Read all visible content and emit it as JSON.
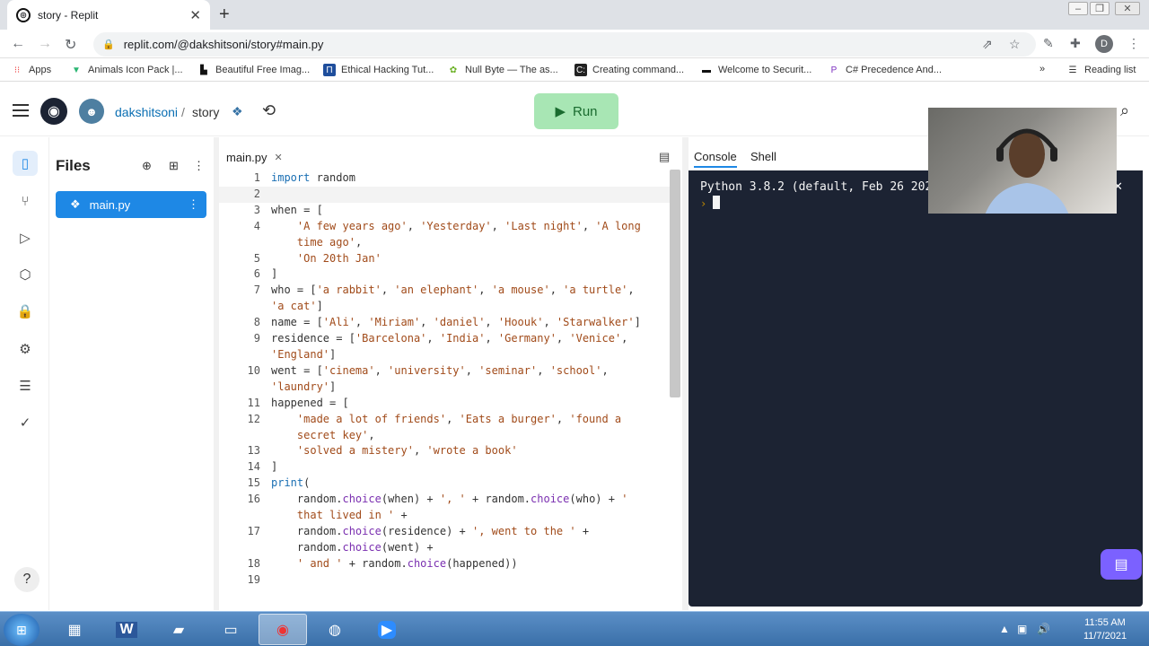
{
  "browser": {
    "tab_title": "story - Replit",
    "url": "replit.com/@dakshitsoni/story#main.py",
    "profile_initial": "D",
    "reading_list": "Reading list",
    "bookmarks": [
      {
        "label": "Apps"
      },
      {
        "label": "Animals Icon Pack |..."
      },
      {
        "label": "Beautiful Free Imag..."
      },
      {
        "label": "Ethical Hacking Tut..."
      },
      {
        "label": "Null Byte — The as..."
      },
      {
        "label": "Creating command..."
      },
      {
        "label": "Welcome to Securit..."
      },
      {
        "label": "C# Precedence And..."
      }
    ]
  },
  "header": {
    "username": "dakshitsoni",
    "separator": "/",
    "repl_name": "story",
    "run_label": "Run"
  },
  "files": {
    "title": "Files",
    "items": [
      {
        "label": "main.py"
      }
    ]
  },
  "editor": {
    "tab_label": "main.py",
    "lines": [
      {
        "n": "1",
        "html": "<span class='kw'>import</span> random"
      },
      {
        "n": "2",
        "html": ""
      },
      {
        "n": "3",
        "html": "when = ["
      },
      {
        "n": "4",
        "html": "    <span class='st'>'A few years ago'</span>, <span class='st'>'Yesterday'</span>, <span class='st'>'Last night'</span>, <span class='st'>'A long</span>"
      },
      {
        "n": "",
        "html": "    <span class='st'>time ago'</span>,"
      },
      {
        "n": "5",
        "html": "    <span class='st'>'On 20th Jan'</span>"
      },
      {
        "n": "6",
        "html": "]"
      },
      {
        "n": "7",
        "html": "who = [<span class='st'>'a rabbit'</span>, <span class='st'>'an elephant'</span>, <span class='st'>'a mouse'</span>, <span class='st'>'a turtle'</span>,"
      },
      {
        "n": "",
        "html": "<span class='st'>'a cat'</span>]"
      },
      {
        "n": "8",
        "html": "name = [<span class='st'>'Ali'</span>, <span class='st'>'Miriam'</span>, <span class='st'>'daniel'</span>, <span class='st'>'Hoouk'</span>, <span class='st'>'Starwalker'</span>]"
      },
      {
        "n": "9",
        "html": "residence = [<span class='st'>'Barcelona'</span>, <span class='st'>'India'</span>, <span class='st'>'Germany'</span>, <span class='st'>'Venice'</span>,"
      },
      {
        "n": "",
        "html": "<span class='st'>'England'</span>]"
      },
      {
        "n": "10",
        "html": "went = [<span class='st'>'cinema'</span>, <span class='st'>'university'</span>, <span class='st'>'seminar'</span>, <span class='st'>'school'</span>,"
      },
      {
        "n": "",
        "html": "<span class='st'>'laundry'</span>]"
      },
      {
        "n": "11",
        "html": "happened = ["
      },
      {
        "n": "12",
        "html": "    <span class='st'>'made a lot of friends'</span>, <span class='st'>'Eats a burger'</span>, <span class='st'>'found a</span>"
      },
      {
        "n": "",
        "html": "    <span class='st'>secret key'</span>,"
      },
      {
        "n": "13",
        "html": "    <span class='st'>'solved a mistery'</span>, <span class='st'>'wrote a book'</span>"
      },
      {
        "n": "14",
        "html": "]"
      },
      {
        "n": "15",
        "html": "<span class='kw'>print</span>("
      },
      {
        "n": "16",
        "html": "    random.<span class='fn'>choice</span>(when) + <span class='st'>', '</span> + random.<span class='fn'>choice</span>(who) + <span class='st'>'</span>"
      },
      {
        "n": "",
        "html": "    <span class='st'>that lived in '</span> +"
      },
      {
        "n": "17",
        "html": "    random.<span class='fn'>choice</span>(residence) + <span class='st'>', went to the '</span> +"
      },
      {
        "n": "",
        "html": "    random.<span class='fn'>choice</span>(went) +"
      },
      {
        "n": "18",
        "html": "    <span class='st'>' and '</span> + random.<span class='fn'>choice</span>(happened))"
      },
      {
        "n": "19",
        "html": ""
      }
    ]
  },
  "console": {
    "tabs": [
      {
        "label": "Console"
      },
      {
        "label": "Shell"
      }
    ],
    "output": "Python 3.8.2 (default, Feb 26 2020",
    "prompt": "›"
  },
  "taskbar": {
    "time": "11:55 AM",
    "date": "11/7/2021"
  },
  "colors": {
    "accent": "#1e88e5",
    "run_bg": "#a8e6b4",
    "console_bg": "#1c2333",
    "chat_btn": "#7b61ff"
  }
}
